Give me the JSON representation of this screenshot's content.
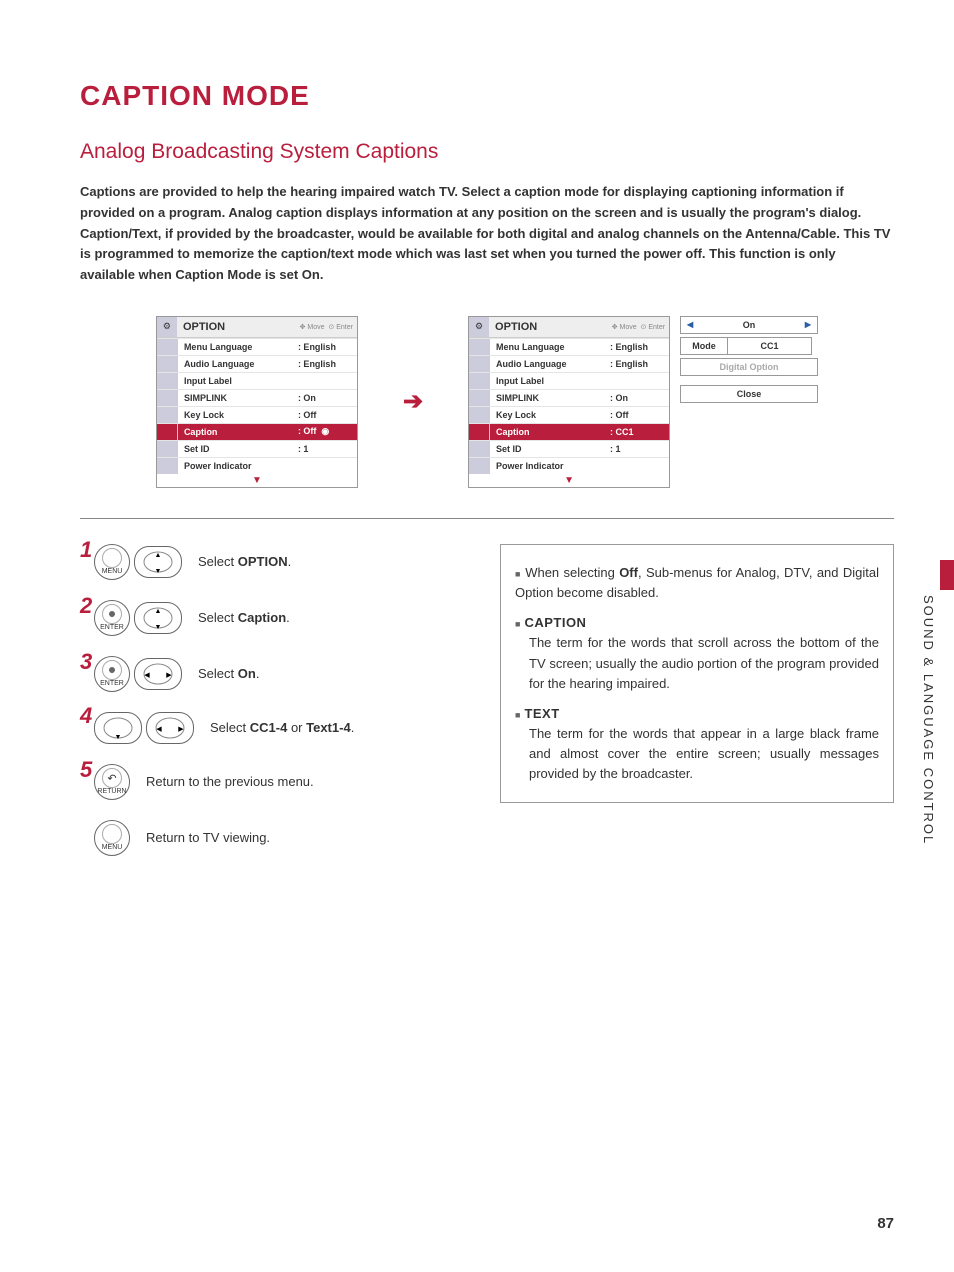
{
  "title": "CAPTION MODE",
  "subtitle": "Analog Broadcasting System Captions",
  "intro_pre": "Captions are provided to help the hearing impaired watch TV. Select a caption mode for displaying captioning information if provided on a program. Analog caption displays information at any position on the screen and is usually the program's dialog. Caption/Text, if provided by the broadcaster, would be available for both digital and analog channels on the Antenna/Cable. This TV is programmed to memorize the caption/text mode which was last set when you turned the power off. This function is only available when ",
  "intro_b1": "Caption",
  "intro_mid": " Mode is set ",
  "intro_b2": "On",
  "intro_post": ".",
  "menu": {
    "title": "OPTION",
    "hints_move": "Move",
    "hints_enter": "Enter",
    "rows": [
      {
        "label": "Menu Language",
        "value": ": English"
      },
      {
        "label": "Audio Language",
        "value": ": English"
      },
      {
        "label": "Input Label",
        "value": ""
      },
      {
        "label": "SIMPLINK",
        "value": ": On"
      },
      {
        "label": "Key Lock",
        "value": ": Off"
      },
      {
        "label": "Caption",
        "value": ": Off"
      },
      {
        "label": "Set ID",
        "value": ": 1"
      },
      {
        "label": "Power Indicator",
        "value": ""
      }
    ],
    "caption_value_right": ": CC1"
  },
  "side": {
    "on": "On",
    "mode": "Mode",
    "cc1": "CC1",
    "digital": "Digital Option",
    "close": "Close"
  },
  "steps": [
    {
      "n": "1",
      "btns": [
        "MENU",
        "DPAD-UD"
      ],
      "pre": "Select ",
      "bold": "OPTION",
      "post": "."
    },
    {
      "n": "2",
      "btns": [
        "ENTER",
        "DPAD-UD"
      ],
      "pre": "Select ",
      "bold": "Caption",
      "post": "."
    },
    {
      "n": "3",
      "btns": [
        "ENTER",
        "DPAD-LR"
      ],
      "pre": "Select ",
      "bold": "On",
      "post": "."
    },
    {
      "n": "4",
      "btns": [
        "DOWN",
        "DPAD-LR"
      ],
      "pre": "Select ",
      "bold": "CC1-4",
      "mid": " or ",
      "bold2": "Text1-4",
      "post": "."
    },
    {
      "n": "5",
      "btns": [
        "RETURN"
      ],
      "plain": "Return to the previous menu."
    },
    {
      "n": "",
      "btns": [
        "MENU"
      ],
      "plain": "Return to TV viewing."
    }
  ],
  "info": {
    "off_pre": "When selecting ",
    "off_b": "Off",
    "off_post": ", Sub-menus for Analog, DTV, and Digital Option become disabled.",
    "caption_h": "CAPTION",
    "caption_t": "The term for the words that scroll across the bottom of the TV screen; usually the audio portion of the program provided for the hearing impaired.",
    "text_h": "TEXT",
    "text_t": "The term for the words that appear in a large black frame and almost cover the entire screen; usually messages provided by the broadcaster."
  },
  "side_label": "SOUND & LANGUAGE CONTROL",
  "page_num": "87",
  "btn_labels": {
    "menu": "MENU",
    "enter": "ENTER",
    "return": "RETURN"
  }
}
